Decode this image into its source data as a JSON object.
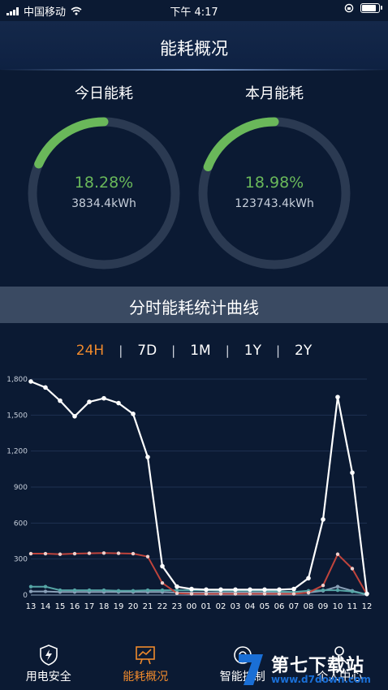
{
  "status_bar": {
    "carrier": "中国移动",
    "time": "下午 4:17"
  },
  "header": {
    "title": "能耗概况"
  },
  "gauges": [
    {
      "label": "今日能耗",
      "percent_text": "18.28%",
      "percent": 0.1828,
      "value": "3834.4kWh"
    },
    {
      "label": "本月能耗",
      "percent_text": "18.98%",
      "percent": 0.1898,
      "value": "123743.4kWh"
    }
  ],
  "section": {
    "title": "分时能耗统计曲线"
  },
  "tabs": [
    "24H",
    "7D",
    "1M",
    "1Y",
    "2Y"
  ],
  "active_tab": "24H",
  "colors": {
    "accent": "#f08a2c",
    "gauge_fill": "#6ab85a",
    "gauge_track": "#2b3a52",
    "series_white": "#ffffff",
    "series_red": "#c0443c",
    "series_teal": "#56a6a6",
    "series_gray": "#8aa0b8"
  },
  "chart_data": {
    "type": "line",
    "categories": [
      "13",
      "14",
      "15",
      "16",
      "17",
      "18",
      "19",
      "20",
      "21",
      "22",
      "23",
      "00",
      "01",
      "02",
      "03",
      "04",
      "05",
      "06",
      "07",
      "08",
      "09",
      "10",
      "11",
      "12"
    ],
    "ylim": [
      0,
      1800
    ],
    "yticks": [
      "0",
      "300",
      "600",
      "900",
      "1,200",
      "1,500",
      "1,800"
    ],
    "ytick_values": [
      0,
      300,
      600,
      900,
      1200,
      1500,
      1800
    ],
    "grid": true,
    "series": [
      {
        "values": [
          1780,
          1730,
          1620,
          1490,
          1610,
          1640,
          1600,
          1510,
          1150,
          240,
          70,
          50,
          45,
          45,
          45,
          45,
          45,
          45,
          50,
          140,
          630,
          1650,
          1020,
          10
        ],
        "color": "#ffffff"
      },
      {
        "values": [
          345,
          345,
          340,
          345,
          348,
          350,
          348,
          345,
          320,
          100,
          15,
          10,
          10,
          10,
          10,
          10,
          10,
          10,
          10,
          20,
          80,
          340,
          220,
          5
        ],
        "color": "#c0443c"
      },
      {
        "values": [
          70,
          70,
          40,
          40,
          40,
          40,
          35,
          35,
          40,
          40,
          40,
          40,
          40,
          35,
          35,
          35,
          35,
          30,
          25,
          35,
          40,
          40,
          30,
          5
        ],
        "color": "#56a6a6"
      },
      {
        "values": [
          30,
          30,
          25,
          25,
          25,
          25,
          25,
          25,
          25,
          25,
          20,
          20,
          20,
          20,
          20,
          20,
          20,
          20,
          15,
          20,
          35,
          70,
          35,
          5
        ],
        "color": "#8aa0b8"
      }
    ]
  },
  "bottom_nav": [
    {
      "label": "用电安全",
      "icon": "shield-lightning-icon"
    },
    {
      "label": "能耗概况",
      "icon": "presentation-chart-icon",
      "active": true
    },
    {
      "label": "智能控制",
      "icon": "smart-control-icon"
    },
    {
      "label": "个人中心",
      "icon": "person-icon"
    }
  ],
  "watermark": {
    "text": "第七下载站",
    "url": "www.d7down.com"
  }
}
